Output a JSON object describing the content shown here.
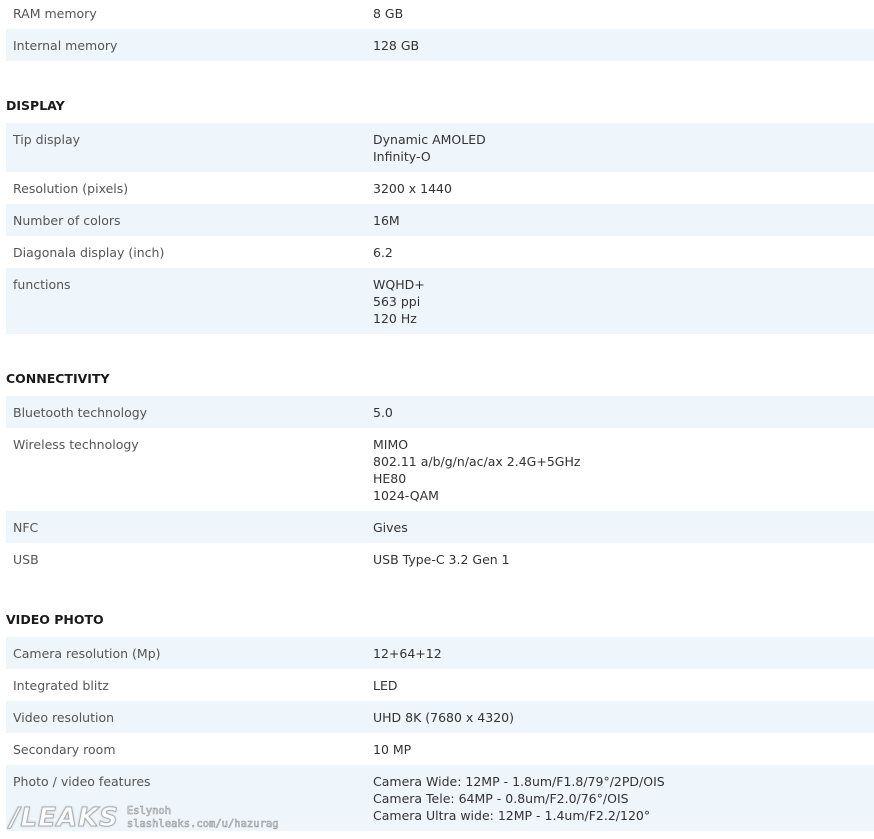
{
  "sections": [
    {
      "title": "",
      "rows": [
        {
          "label": "RAM memory",
          "values": [
            "8 GB"
          ]
        },
        {
          "label": "Internal memory",
          "values": [
            "128 GB"
          ]
        }
      ]
    },
    {
      "title": "DISPLAY",
      "rows": [
        {
          "label": "Tip display",
          "values": [
            "Dynamic AMOLED",
            "Infinity-O"
          ]
        },
        {
          "label": "Resolution (pixels)",
          "values": [
            "3200 x 1440"
          ]
        },
        {
          "label": "Number of colors",
          "values": [
            "16M"
          ]
        },
        {
          "label": "Diagonala display (inch)",
          "values": [
            "6.2"
          ]
        },
        {
          "label": "functions",
          "values": [
            "WQHD+",
            "563 ppi",
            "120 Hz"
          ]
        }
      ]
    },
    {
      "title": "CONNECTIVITY",
      "rows": [
        {
          "label": "Bluetooth technology",
          "values": [
            "5.0"
          ]
        },
        {
          "label": "Wireless technology",
          "values": [
            "MIMO",
            "802.11 a/b/g/n/ac/ax 2.4G+5GHz",
            "HE80",
            "1024-QAM"
          ]
        },
        {
          "label": "NFC",
          "values": [
            "Gives"
          ]
        },
        {
          "label": "USB",
          "values": [
            "USB Type-C 3.2 Gen 1"
          ]
        }
      ]
    },
    {
      "title": "VIDEO PHOTO",
      "rows": [
        {
          "label": "Camera resolution (Mp)",
          "values": [
            "12+64+12"
          ]
        },
        {
          "label": "Integrated blitz",
          "values": [
            "LED"
          ]
        },
        {
          "label": "Video resolution",
          "values": [
            "UHD 8K (7680 x 4320)"
          ]
        },
        {
          "label": "Secondary room",
          "values": [
            "10 MP"
          ]
        },
        {
          "label": "Photo / video features",
          "values": [
            "Camera Wide: 12MP - 1.8um/F1.8/79°/2PD/OIS",
            "Camera Tele: 64MP - 0.8um/F2.0/76°/OIS",
            "Camera Ultra wide: 12MP - 1.4um/F2.2/120°"
          ]
        }
      ]
    }
  ],
  "watermark": {
    "logo": "/LEAKS",
    "line1": "Eslynoh",
    "line2": "slashleaks.com/u/hazurag"
  },
  "colors": {
    "row_shade": "#eef5fb",
    "heading": "#1a1a1a",
    "label": "#555555"
  }
}
